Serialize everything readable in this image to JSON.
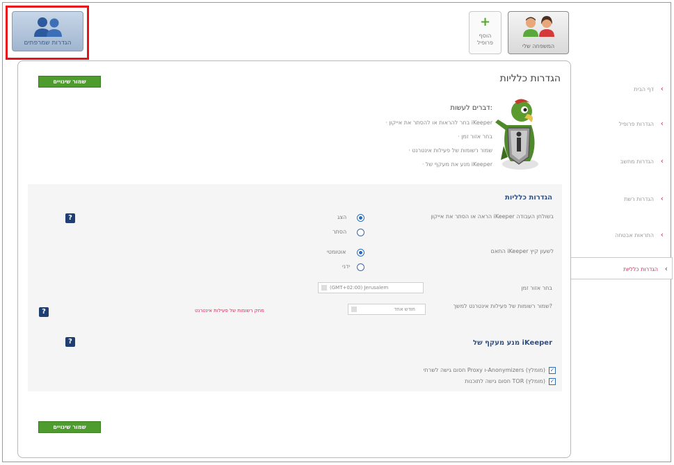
{
  "top": {
    "parental_label": "הגדרות שמרפתים",
    "family_label": "המשפחה שלי",
    "add_profile_label_1": "הוסף",
    "add_profile_label_2": "פרופיל"
  },
  "panel": {
    "title": "הגדרות כלליות",
    "save_label": "שמור שינויים",
    "todo_title": "דברים לעשות:",
    "todo_items": [
      "בחר להראות או להסתר את אייקון iKeeper",
      "בחר אזור זמן",
      "שמור רשומות של פעילות אינטרנט",
      "מנע את מעקף של iKeeper"
    ]
  },
  "general": {
    "title": "הגדרות כלליות",
    "icon_label": "הראה או הסתר את אייקון iKeeper בשולחן העבודה",
    "show_label": "הצג",
    "hide_label": "הסתר",
    "dst_label": "התאם iKeeper לשעון קיץ",
    "auto_label": "אוטומטי",
    "manual_label": "ידני",
    "timezone_label": "בחר אזור זמן",
    "timezone_value": "(GMT+02:00) Jerusalem",
    "records_label": "שמור רשומות של פעילות אינטרנט למשך?",
    "records_value": "חודש אחד",
    "clear_records_link": "מחק רשומות של פעילות אינטרנט",
    "help_glyph": "?"
  },
  "bypass": {
    "title": "מנע מעקף של iKeeper",
    "option1": "חסום גישה לשרתי Proxy ו-Anonymizers (מומלץ)",
    "option2": "חסום גישה לתוכנות TOR (מומלץ)",
    "check_glyph": "✓"
  },
  "nav": {
    "arrow": "‹",
    "items": [
      "דף הבית",
      "הגדרות פרופיל",
      "הגדרות מחשב",
      "הגדרות רשת",
      "התראות אבטחה",
      "הגדרות כלליות"
    ]
  },
  "colors": {
    "accent_pink": "#d0305a",
    "green": "#4e9c2d",
    "navy": "#1f3e72",
    "highlight_red": "#e8121b"
  }
}
